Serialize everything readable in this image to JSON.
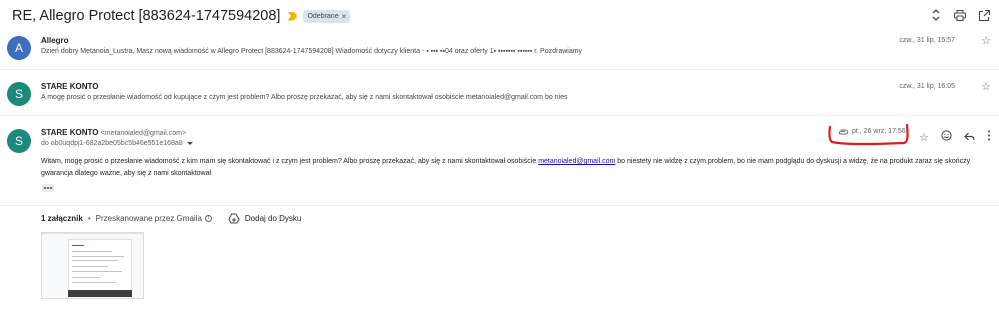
{
  "header": {
    "subject": "RE, Allegro Protect [883624-1747594208]",
    "label": "Odebrane",
    "label_close": "×"
  },
  "messages": [
    {
      "avatar_letter": "A",
      "avatar_color": "#3c6fbf",
      "sender": "Allegro",
      "snippet": "Dzień dobry Metanoia_Lustra, Masz nową wiadomość w Allegro Protect [883624-1747594208] Wiadomość dotyczy klienta - ▪ ▪▪▪ ▪▪04 oraz oferty 1▪ ▪▪▪▪▪▪▪ ▪▪▪▪▪▪ r. Pozdrawiamy",
      "date": "czw., 31 lip, 15:57"
    },
    {
      "avatar_letter": "S",
      "avatar_color": "#1b8a7a",
      "sender": "STARE KONTO",
      "snippet": "A mogę prosić o przesłanie wiadomość od kupujące z czym jest problem? Albo proszę przekazać, aby się z nami skontaktował osobiście metanoialed@gmail.com bo nies",
      "date": "czw., 31 lip, 16:05"
    },
    {
      "avatar_letter": "S",
      "avatar_color": "#1b8a7a",
      "sender": "STARE KONTO",
      "sender_email": "<metanoialed@gmail.com>",
      "to": "do ob0uqdpj1-682a2be05bc5b46e551e168a8",
      "date": "pt., 26 wrz, 17:56",
      "body_part1": "Witam, mogę prosić o przesłanie wiadomość z kim mam się skontaktować i  z czym jest problem? Albo proszę przekazać, aby się z nami skontaktował osobiście ",
      "body_link": "metanoialed@gmail.com",
      "body_part2": " bo niestety nie widzę z czym problem, bo nie mam podglądu do dyskusji a widzę, że na produkt zaraz się skończy gwarancja dlatego ważne, aby się z nami skontaktował"
    }
  ],
  "attachments": {
    "count_label": "1 załącznik",
    "separator": "•",
    "scanned_label": "Przeskanowane przez Gmaila",
    "drive_label": "Dodaj do Dysku"
  },
  "colors": {
    "annotation_red": "#e01a1a",
    "link_blue": "#1a0dab",
    "importance_yellow": "#f4b400"
  }
}
